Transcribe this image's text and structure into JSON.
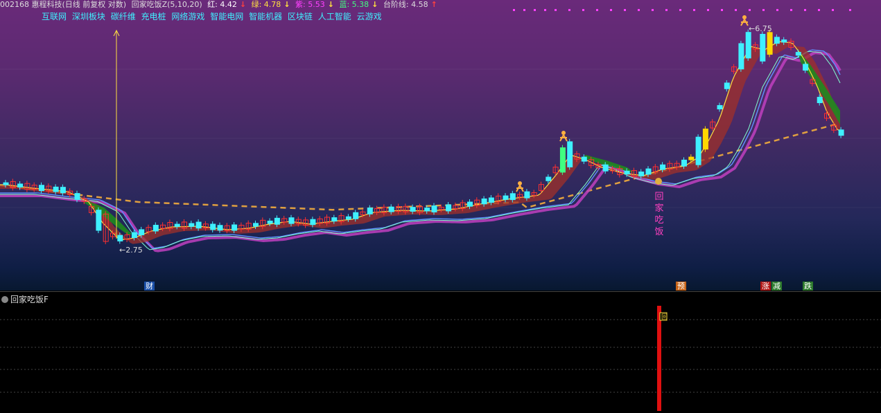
{
  "header": {
    "code_name": "002168 惠程科技(日线 前复权 对数)",
    "indicator": "回家吃饭Z(5,10,20)",
    "red_label": "红: 4.42",
    "green_label": "绿: 4.78",
    "purple_label": "紫: 5.53",
    "blue_label": "蓝: 5.38",
    "step_label": "台阶线: 4.58"
  },
  "concept_tags": [
    "互联网",
    "深圳板块",
    "碳纤维",
    "充电桩",
    "网络游戏",
    "智能电网",
    "智能机器",
    "区块链",
    "人工智能",
    "云游戏"
  ],
  "price_labels": {
    "low": "←2.75",
    "high": "←6.75"
  },
  "signal_text": [
    "回",
    "家",
    "吃",
    "饭"
  ],
  "bottom_marks": {
    "cai": "财",
    "yu": "预",
    "zhang": "涨",
    "jian": "减",
    "die": "跌"
  },
  "sub_panel": {
    "title": "回家吃饭F",
    "flag": "回"
  },
  "colors": {
    "up": "#ff3030",
    "down": "#3ff0ff",
    "yellow": "#ffd700",
    "green": "#22aa22",
    "step": "#e0a040"
  },
  "chart_data": {
    "type": "candlestick",
    "price_range": [
      2.75,
      6.75
    ],
    "series": [
      {
        "name": "台阶线",
        "last": 4.58
      }
    ]
  }
}
